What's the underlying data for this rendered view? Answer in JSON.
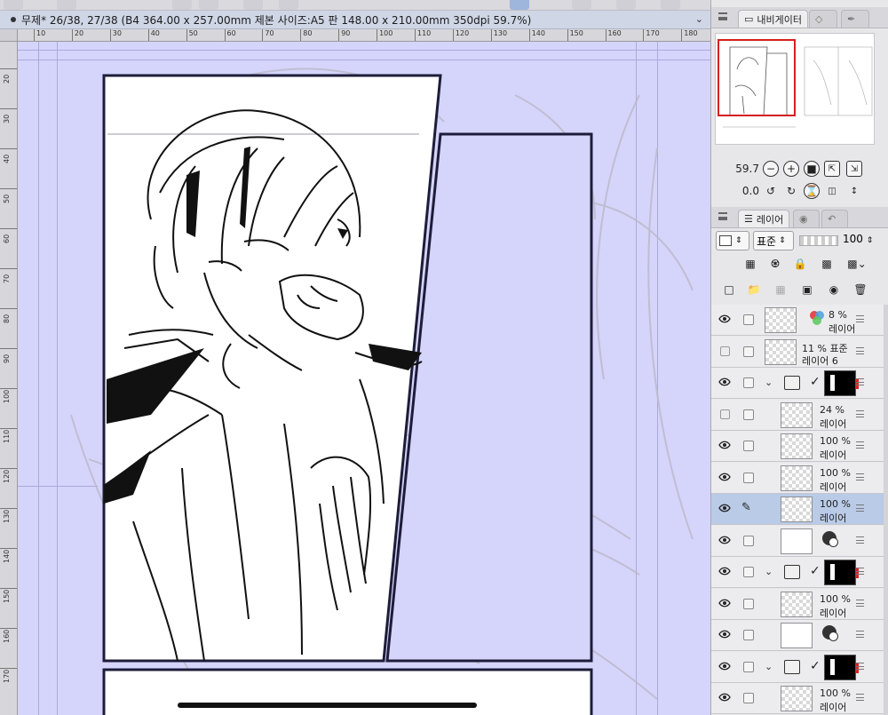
{
  "document": {
    "title": "무제* 26/38, 27/38 (B4 364.00 x 257.00mm 제본 사이즈:A5 판 148.00 x 210.00mm 350dpi 59.7%)"
  },
  "rulers": {
    "horizontal": [
      "10",
      "20",
      "30",
      "40",
      "50",
      "60",
      "70",
      "80",
      "90",
      "100",
      "110",
      "120",
      "130",
      "140",
      "150",
      "160",
      "170",
      "180"
    ],
    "vertical": [
      "20",
      "30",
      "40",
      "50",
      "60",
      "70",
      "80",
      "90",
      "100",
      "110",
      "120",
      "130",
      "140",
      "150",
      "160",
      "170"
    ]
  },
  "navigator": {
    "tab_label": "내비게이터",
    "zoom_value": "59.7",
    "rotation_value": "0.0"
  },
  "layer_panel": {
    "tab_label": "레이어",
    "blend_mode": "표준",
    "opacity": "100",
    "layers": [
      {
        "pct": "8 %",
        "name": "레이어",
        "visible": true,
        "type": "color"
      },
      {
        "pct": "11 % 표준",
        "name": "레이어 6",
        "visible": false,
        "type": "raster"
      },
      {
        "pct": "",
        "name": "",
        "visible": true,
        "type": "folder"
      },
      {
        "pct": "24 %",
        "name": "레이어",
        "visible": false,
        "type": "raster"
      },
      {
        "pct": "100 %",
        "name": "레이어",
        "visible": true,
        "type": "raster"
      },
      {
        "pct": "100 %",
        "name": "레이어",
        "visible": true,
        "type": "raster"
      },
      {
        "pct": "100 %",
        "name": "레이어",
        "visible": true,
        "type": "raster",
        "selected": true
      },
      {
        "pct": "",
        "name": "",
        "visible": true,
        "type": "paper"
      },
      {
        "pct": "",
        "name": "",
        "visible": true,
        "type": "folder"
      },
      {
        "pct": "100 %",
        "name": "레이어",
        "visible": true,
        "type": "raster"
      },
      {
        "pct": "",
        "name": "",
        "visible": true,
        "type": "paper"
      },
      {
        "pct": "",
        "name": "",
        "visible": true,
        "type": "folder"
      },
      {
        "pct": "100 %",
        "name": "레이어",
        "visible": true,
        "type": "raster"
      }
    ]
  },
  "colors": {
    "canvas_bg": "#d5d4fb",
    "selected_layer": "#b9cbe6",
    "nav_frame": "#d52020"
  }
}
